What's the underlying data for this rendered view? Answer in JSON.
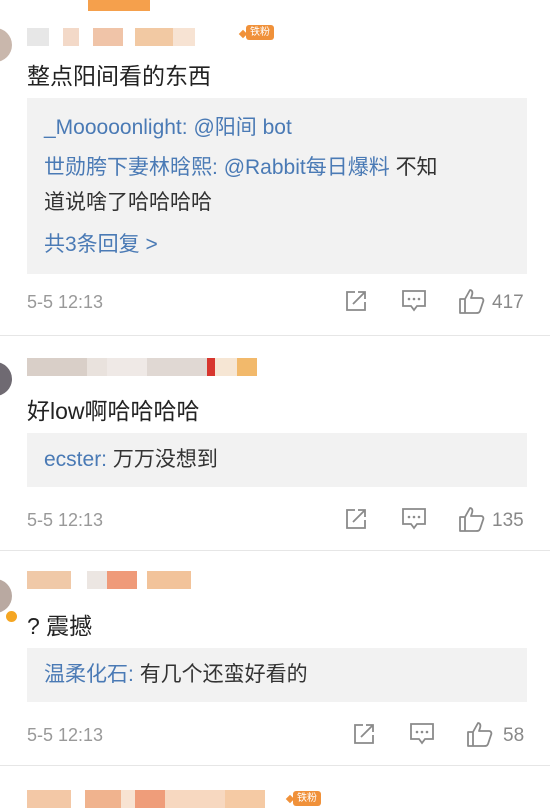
{
  "comments": [
    {
      "badge": "铁粉",
      "text": "整点阳间看的东西",
      "reply1_user": "_Mooooonlight:",
      "reply1_text": "@阳间 bot",
      "reply2_user": "世勋胯下妻林晗熙:",
      "reply2_mention": "@Rabbit每日爆料",
      "reply2_text_a": "不知",
      "reply2_text_b": "道说啥了哈哈哈哈",
      "more_replies": "共3条回复 >",
      "time": "5-5 12:13",
      "likes": "417"
    },
    {
      "text": "好low啊哈哈哈哈",
      "reply1_user": "ecster:",
      "reply1_text": "万万没想到",
      "time": "5-5 12:13",
      "likes": "135"
    },
    {
      "text": "? 震撼",
      "reply1_user": "温柔化石:",
      "reply1_text": "有几个还蛮好看的",
      "time": "5-5 12:13",
      "likes": "58"
    },
    {
      "badge": "铁粉"
    }
  ],
  "colors": {
    "link": "#4a7ab5",
    "badge": "#f0913a",
    "muted": "#999999"
  },
  "icons": [
    "share-icon",
    "comment-icon",
    "like-icon"
  ]
}
